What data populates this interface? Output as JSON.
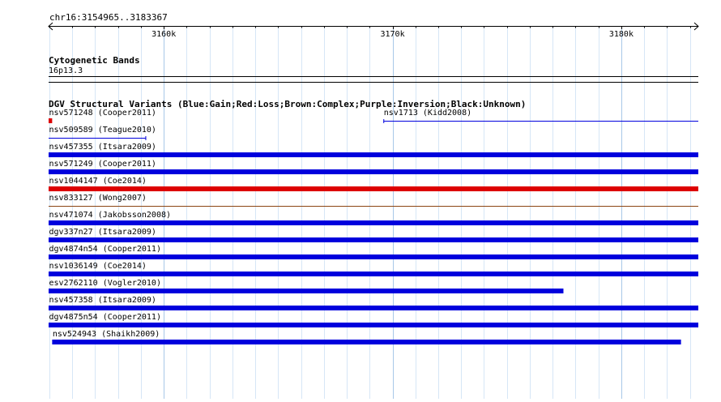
{
  "region": {
    "label": "chr16:3154965..3183367",
    "start": 3154965,
    "end": 3183367
  },
  "ruler": {
    "ticks": [
      {
        "pos": 3160000,
        "label": "3160k"
      },
      {
        "pos": 3170000,
        "label": "3170k"
      },
      {
        "pos": 3180000,
        "label": "3180k"
      }
    ]
  },
  "cytoband": {
    "title": "Cytogenetic Bands",
    "band": "16p13.3"
  },
  "dgv": {
    "title": "DGV Structural Variants (Blue:Gain;Red:Loss;Brown:Complex;Purple:Inversion;Black:Unknown)",
    "colors": {
      "gain": "#0000dd",
      "loss": "#dd0000",
      "complex": "#8b4513",
      "inversion": "#800080",
      "unknown": "#000000"
    },
    "rows": [
      [
        {
          "name": "nsv571248 (Cooper2011)",
          "type": "loss",
          "start": 3154965,
          "end": 3155120,
          "style": "bar"
        },
        {
          "name": "nsv1713 (Kidd2008)",
          "type": "gain",
          "start": 3169600,
          "end": 3183367,
          "style": "line"
        }
      ],
      [
        {
          "name": "nsv509589 (Teague2010)",
          "type": "gain",
          "start": 3154965,
          "end": 3159230,
          "style": "line"
        }
      ],
      [
        {
          "name": "nsv457355 (Itsara2009)",
          "type": "gain",
          "start": 3154965,
          "end": 3183367,
          "style": "bar"
        }
      ],
      [
        {
          "name": "nsv571249 (Cooper2011)",
          "type": "gain",
          "start": 3154965,
          "end": 3183367,
          "style": "bar"
        }
      ],
      [
        {
          "name": "nsv1044147 (Coe2014)",
          "type": "loss",
          "start": 3154965,
          "end": 3183367,
          "style": "bar"
        }
      ],
      [
        {
          "name": "nsv833127 (Wong2007)",
          "type": "complex",
          "start": 3154965,
          "end": 3183367,
          "style": "line"
        }
      ],
      [
        {
          "name": "nsv471074 (Jakobsson2008)",
          "type": "gain",
          "start": 3154965,
          "end": 3183367,
          "style": "bar"
        }
      ],
      [
        {
          "name": "dgv337n27 (Itsara2009)",
          "type": "gain",
          "start": 3154965,
          "end": 3183367,
          "style": "bar"
        }
      ],
      [
        {
          "name": "dgv4874n54 (Cooper2011)",
          "type": "gain",
          "start": 3154965,
          "end": 3183367,
          "style": "bar"
        }
      ],
      [
        {
          "name": "nsv1036149 (Coe2014)",
          "type": "gain",
          "start": 3154965,
          "end": 3183367,
          "style": "bar"
        }
      ],
      [
        {
          "name": "esv2762110 (Vogler2010)",
          "type": "gain",
          "start": 3154965,
          "end": 3177470,
          "style": "bar"
        }
      ],
      [
        {
          "name": "nsv457358 (Itsara2009)",
          "type": "gain",
          "start": 3154965,
          "end": 3183367,
          "style": "bar"
        }
      ],
      [
        {
          "name": "dgv4875n54 (Cooper2011)",
          "type": "gain",
          "start": 3154965,
          "end": 3183367,
          "style": "bar"
        }
      ],
      [
        {
          "name": "nsv524943 (Shaikh2009)",
          "type": "gain",
          "start": 3155120,
          "end": 3182610,
          "style": "bar"
        }
      ]
    ]
  }
}
